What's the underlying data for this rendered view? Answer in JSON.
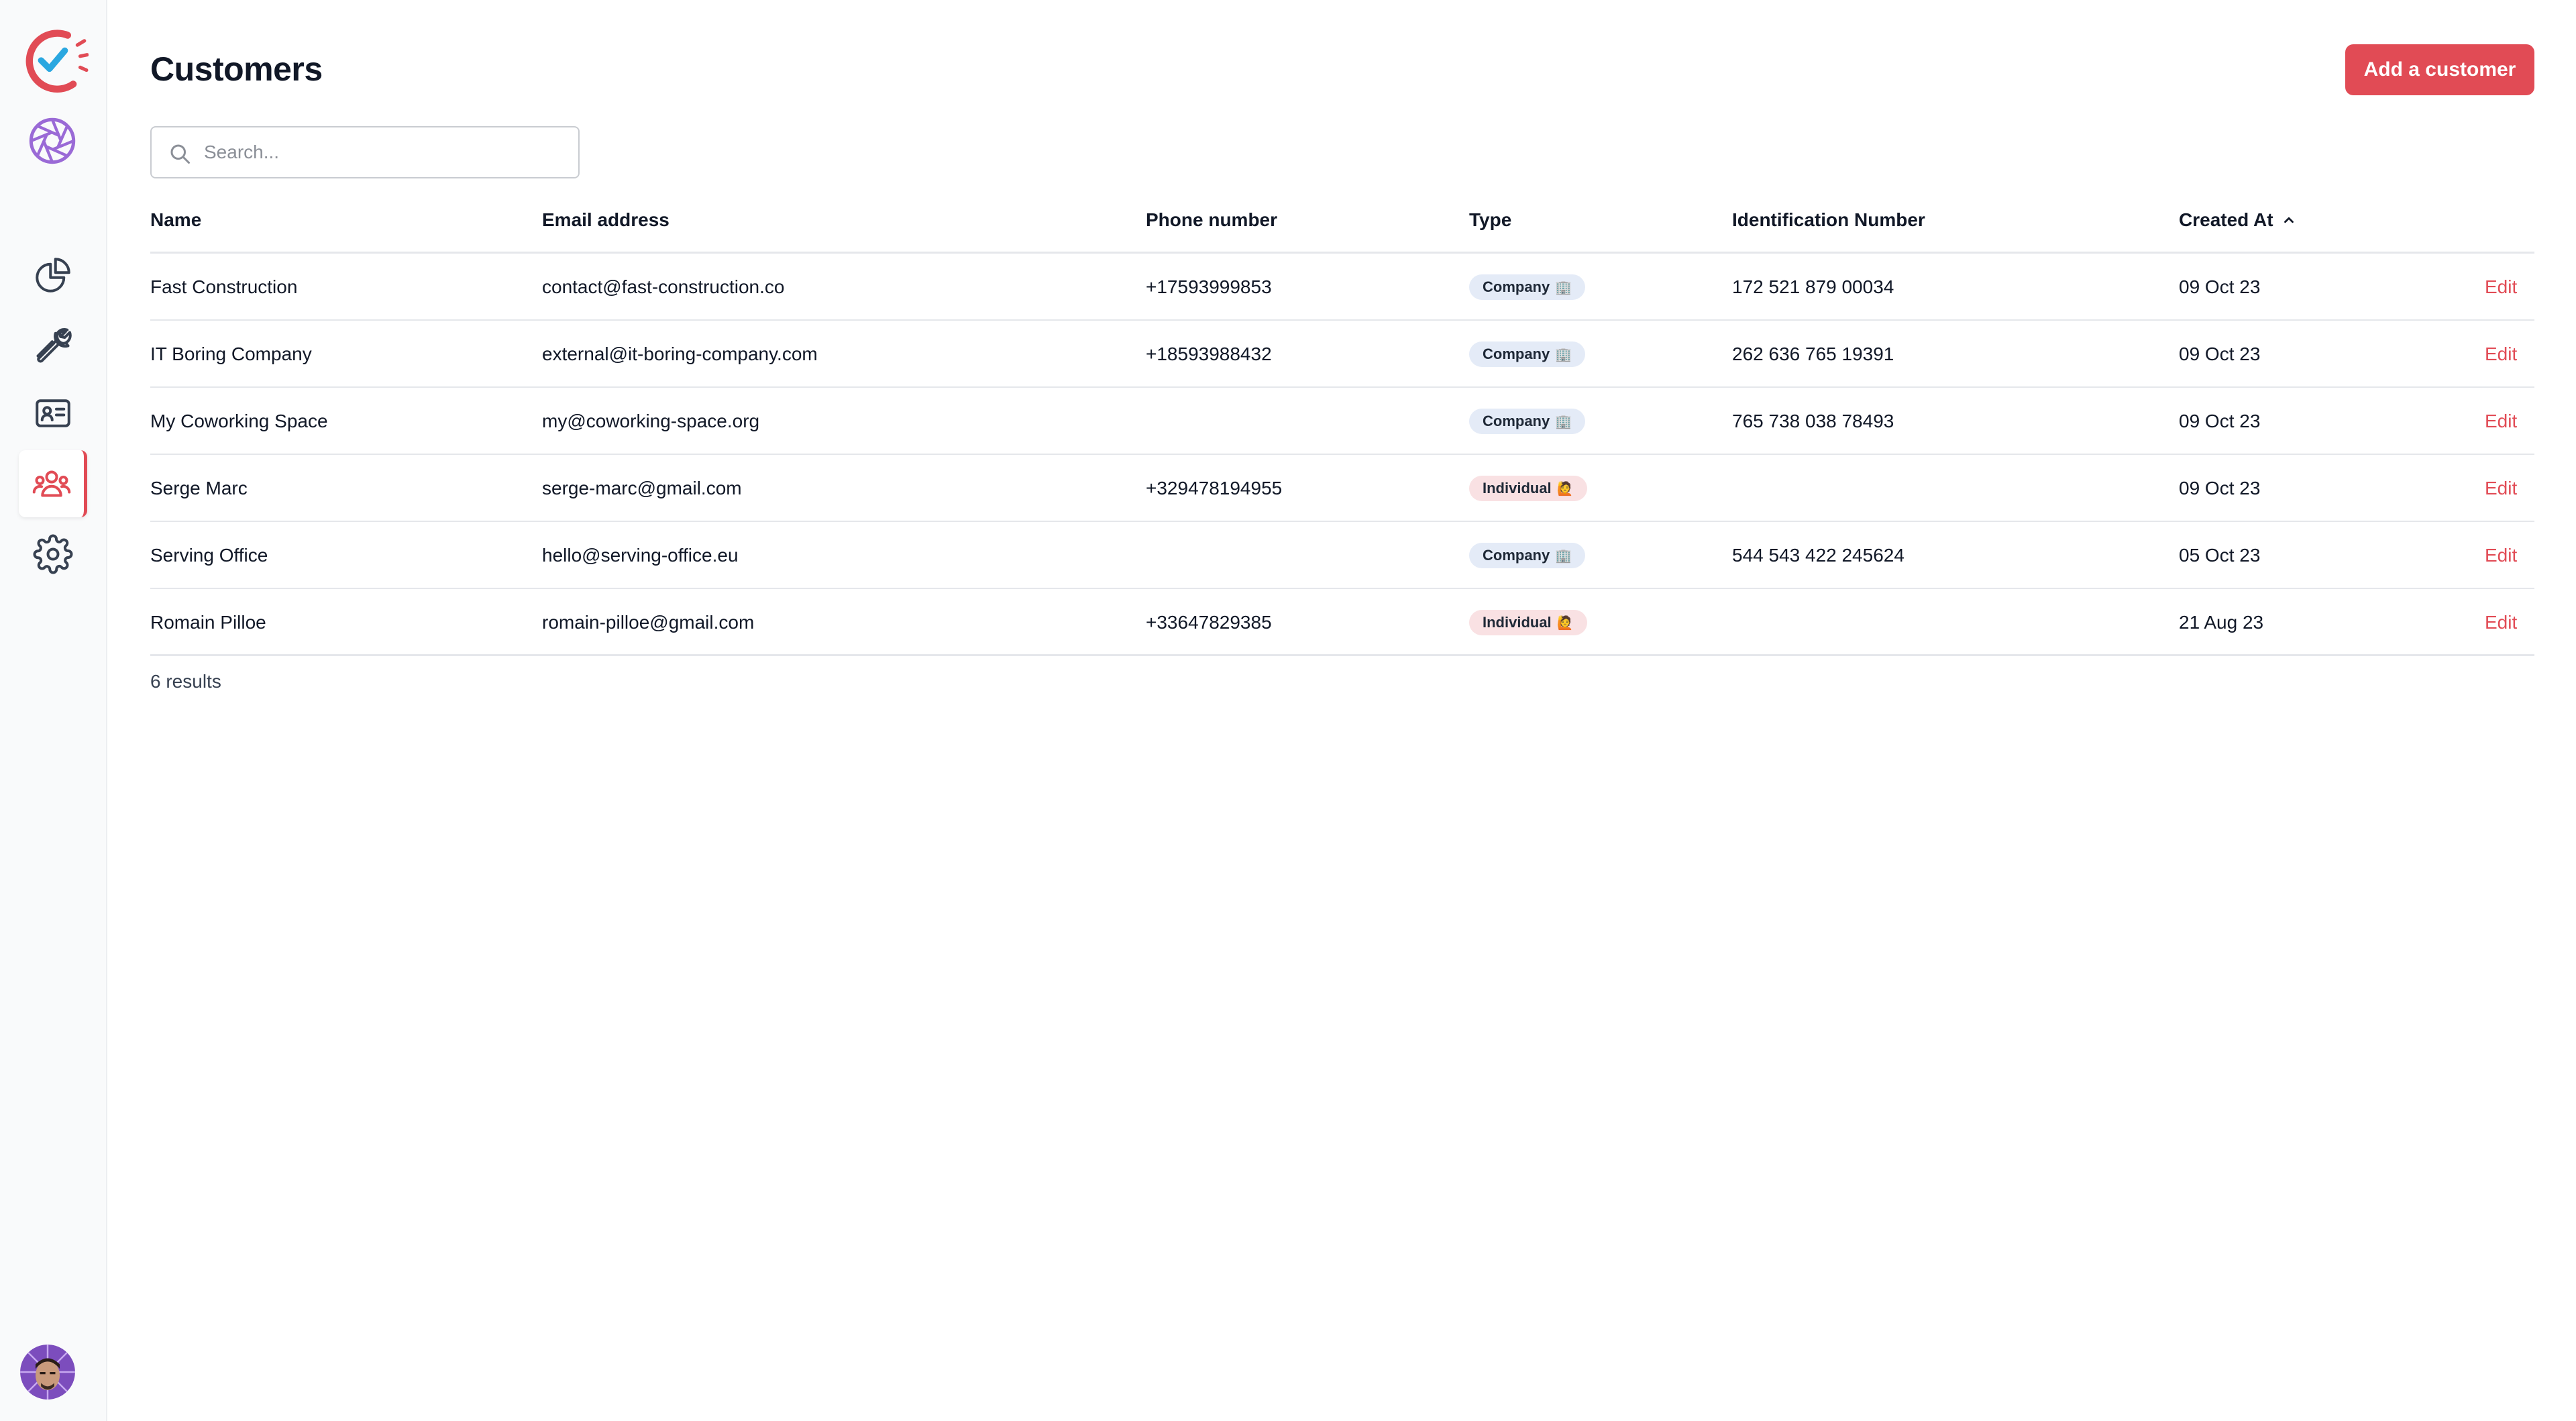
{
  "page": {
    "title": "Customers",
    "add_button": "Add a customer",
    "search_placeholder": "Search...",
    "results_count": "6 results"
  },
  "colors": {
    "accent": "#e14b55",
    "company_badge_bg": "#e4ebf7",
    "individual_badge_bg": "#f9e1e3"
  },
  "sidebar": {
    "items": [
      {
        "icon": "pie-chart-icon",
        "active": false
      },
      {
        "icon": "wrench-icon",
        "active": false
      },
      {
        "icon": "contact-card-icon",
        "active": false
      },
      {
        "icon": "users-icon",
        "active": true
      },
      {
        "icon": "gear-icon",
        "active": false
      }
    ]
  },
  "table": {
    "headers": {
      "name": "Name",
      "email": "Email address",
      "phone": "Phone number",
      "type": "Type",
      "id_number": "Identification Number",
      "created_at": "Created At"
    },
    "sort": {
      "column": "created_at",
      "direction": "ascending-indicator"
    },
    "rows": [
      {
        "name": "Fast Construction",
        "email": "contact@fast-construction.co",
        "phone": "+17593999853",
        "type": "Company",
        "type_emoji": "🏢",
        "id_number": "172 521 879 00034",
        "created_at": "09 Oct 23",
        "action": "Edit"
      },
      {
        "name": "IT Boring Company",
        "email": "external@it-boring-company.com",
        "phone": "+18593988432",
        "type": "Company",
        "type_emoji": "🏢",
        "id_number": "262 636 765 19391",
        "created_at": "09 Oct 23",
        "action": "Edit"
      },
      {
        "name": "My Coworking Space",
        "email": "my@coworking-space.org",
        "phone": "",
        "type": "Company",
        "type_emoji": "🏢",
        "id_number": "765 738 038 78493",
        "created_at": "09 Oct 23",
        "action": "Edit"
      },
      {
        "name": "Serge Marc",
        "email": "serge-marc@gmail.com",
        "phone": "+329478194955",
        "type": "Individual",
        "type_emoji": "🙋",
        "id_number": "",
        "created_at": "09 Oct 23",
        "action": "Edit"
      },
      {
        "name": "Serving Office",
        "email": "hello@serving-office.eu",
        "phone": "",
        "type": "Company",
        "type_emoji": "🏢",
        "id_number": "544 543 422 245624",
        "created_at": "05 Oct 23",
        "action": "Edit"
      },
      {
        "name": "Romain Pilloe",
        "email": "romain-pilloe@gmail.com",
        "phone": "+33647829385",
        "type": "Individual",
        "type_emoji": "🙋",
        "id_number": "",
        "created_at": "21 Aug 23",
        "action": "Edit"
      }
    ]
  }
}
